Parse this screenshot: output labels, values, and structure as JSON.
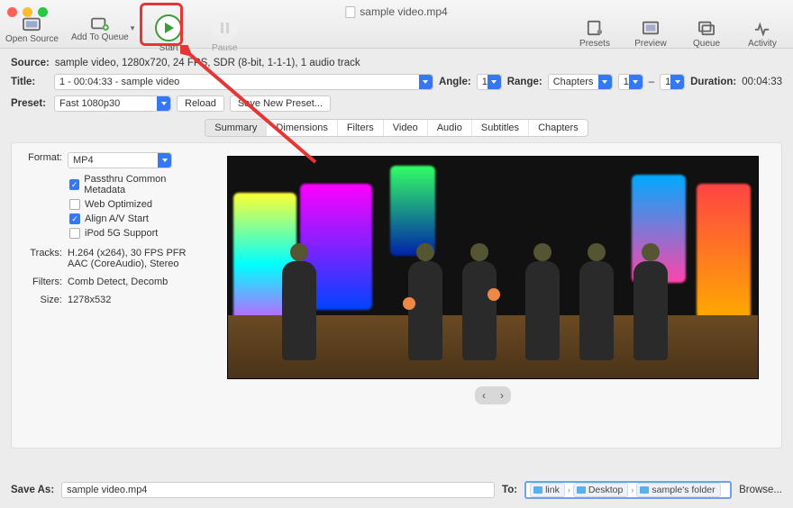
{
  "window": {
    "title": "sample video.mp4"
  },
  "toolbar": {
    "open_source": "Open Source",
    "add_queue": "Add To Queue",
    "start": "Start",
    "pause": "Pause",
    "presets": "Presets",
    "preview": "Preview",
    "queue": "Queue",
    "activity": "Activity"
  },
  "info": {
    "source_label": "Source:",
    "source_value": "sample video, 1280x720, 24 FPS, SDR (8-bit, 1-1-1), 1 audio track",
    "title_label": "Title:",
    "title_value": "1 - 00:04:33 - sample video",
    "angle_label": "Angle:",
    "angle_value": "1",
    "range_label": "Range:",
    "range_type": "Chapters",
    "range_from": "1",
    "range_to": "1",
    "duration_label": "Duration:",
    "duration_value": "00:04:33",
    "preset_label": "Preset:",
    "preset_value": "Fast 1080p30",
    "reload": "Reload",
    "save_preset": "Save New Preset..."
  },
  "tabs": {
    "summary": "Summary",
    "dimensions": "Dimensions",
    "filters": "Filters",
    "video": "Video",
    "audio": "Audio",
    "subtitles": "Subtitles",
    "chapters": "Chapters"
  },
  "summary": {
    "format_label": "Format:",
    "format_value": "MP4",
    "chk_metadata": "Passthru Common Metadata",
    "chk_web": "Web Optimized",
    "chk_av": "Align A/V Start",
    "chk_ipod": "iPod 5G Support",
    "tracks_label": "Tracks:",
    "tracks_value1": "H.264 (x264), 30 FPS PFR",
    "tracks_value2": "AAC (CoreAudio), Stereo",
    "filters_label": "Filters:",
    "filters_value": "Comb Detect, Decomb",
    "size_label": "Size:",
    "size_value": "1278x532"
  },
  "footer": {
    "saveas_label": "Save As:",
    "saveas_value": "sample video.mp4",
    "to_label": "To:",
    "crumb1": "link",
    "crumb2": "Desktop",
    "crumb3": "sample's folder",
    "browse": "Browse..."
  }
}
